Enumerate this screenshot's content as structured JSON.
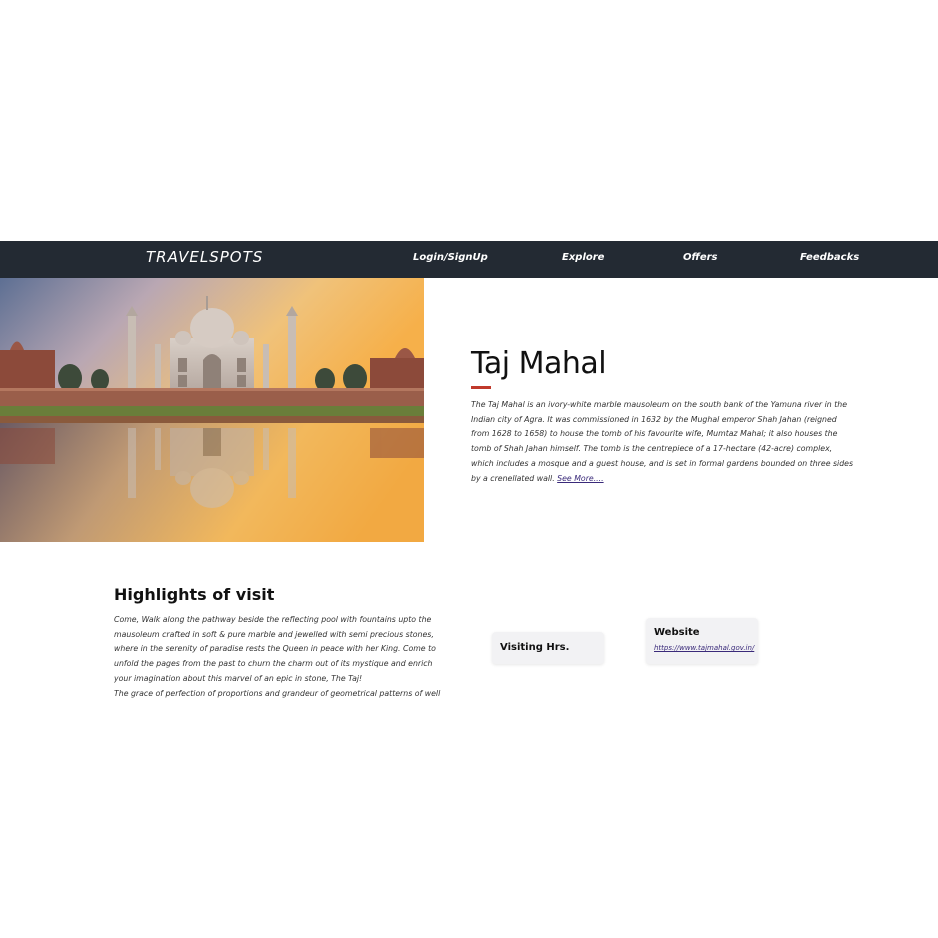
{
  "navbar": {
    "brand": "TRAVELSPOTS",
    "links": [
      {
        "label": "Login/SignUp"
      },
      {
        "label": "Explore"
      },
      {
        "label": "Offers"
      },
      {
        "label": "Feedbacks"
      }
    ],
    "background_color": "#232a33"
  },
  "hero": {
    "image_description_icon": "taj-mahal-photo",
    "title": "Taj Mahal",
    "accent_color": "#c0392b",
    "description": "The Taj Mahal is an ivory-white marble mausoleum on the south bank of the Yamuna river in the Indian city of Agra. It was commissioned in 1632 by the Mughal emperor Shah Jahan (reigned from 1628 to 1658) to house the tomb of his favourite wife, Mumtaz Mahal; it also houses the tomb of Shah Jahan himself. The tomb is the centrepiece of a 17-hectare (42-acre) complex, which includes a mosque and a guest house, and is set in formal gardens bounded on three sides by a crenellated wall.",
    "see_more_label": "See More...."
  },
  "highlights": {
    "title": "Highlights of visit",
    "paragraphs": [
      "Come, Walk along the pathway beside the reflecting pool with fountains upto the mausoleum crafted in soft & pure marble and jewelled with semi precious stones, where in the serenity of paradise rests the Queen in peace with her King. Come to unfold the pages from the past to churn the charm out of its mystique and enrich your imagination about this marvel of an epic in stone, The Taj!",
      "The grace of perfection of proportions and grandeur of geometrical patterns of well"
    ]
  },
  "cards": {
    "visiting": {
      "title": "Visiting Hrs."
    },
    "website": {
      "title": "Website",
      "link": "https://www.tajmahal.gov.in/"
    }
  }
}
